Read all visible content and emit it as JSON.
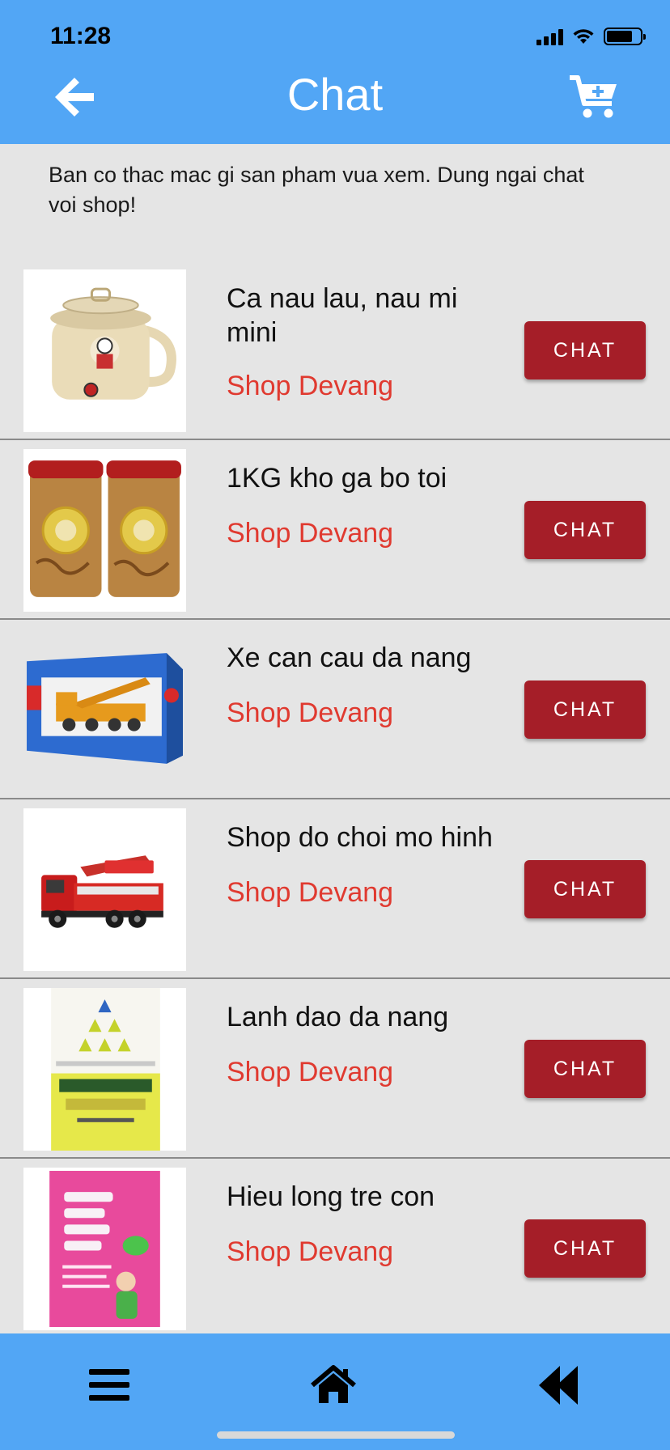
{
  "status": {
    "time": "11:28"
  },
  "header": {
    "title": "Chat",
    "back_icon": "arrow-left-icon",
    "cart_icon": "cart-plus-icon"
  },
  "intro": "Ban co thac mac gi san pham vua xem. Dung ngai chat voi shop!",
  "products": [
    {
      "name": "Ca nau lau, nau mi mini",
      "shop": "Shop Devang",
      "button": "CHAT",
      "image": "electric-cooker-image"
    },
    {
      "name": "1KG kho ga bo toi",
      "shop": "Shop Devang",
      "button": "CHAT",
      "image": "dried-chicken-jars-image"
    },
    {
      "name": "Xe can cau da nang",
      "shop": "Shop Devang",
      "button": "CHAT",
      "image": "crane-truck-toy-image"
    },
    {
      "name": "Shop do choi mo hinh",
      "shop": "Shop Devang",
      "button": "CHAT",
      "image": "fire-truck-toy-image"
    },
    {
      "name": "Lanh dao da nang",
      "shop": "Shop Devang",
      "button": "CHAT",
      "image": "book-cover-leadership-image"
    },
    {
      "name": "Hieu long tre con",
      "shop": "Shop Devang",
      "button": "CHAT",
      "image": "book-cover-children-image"
    }
  ],
  "bottom_nav": {
    "menu_icon": "menu-icon",
    "home_icon": "home-icon",
    "rewind_icon": "rewind-icon"
  },
  "colors": {
    "bar": "#52a6f5",
    "button": "#a51e28",
    "shop_text": "#e03a30",
    "background": "#e5e5e5"
  }
}
